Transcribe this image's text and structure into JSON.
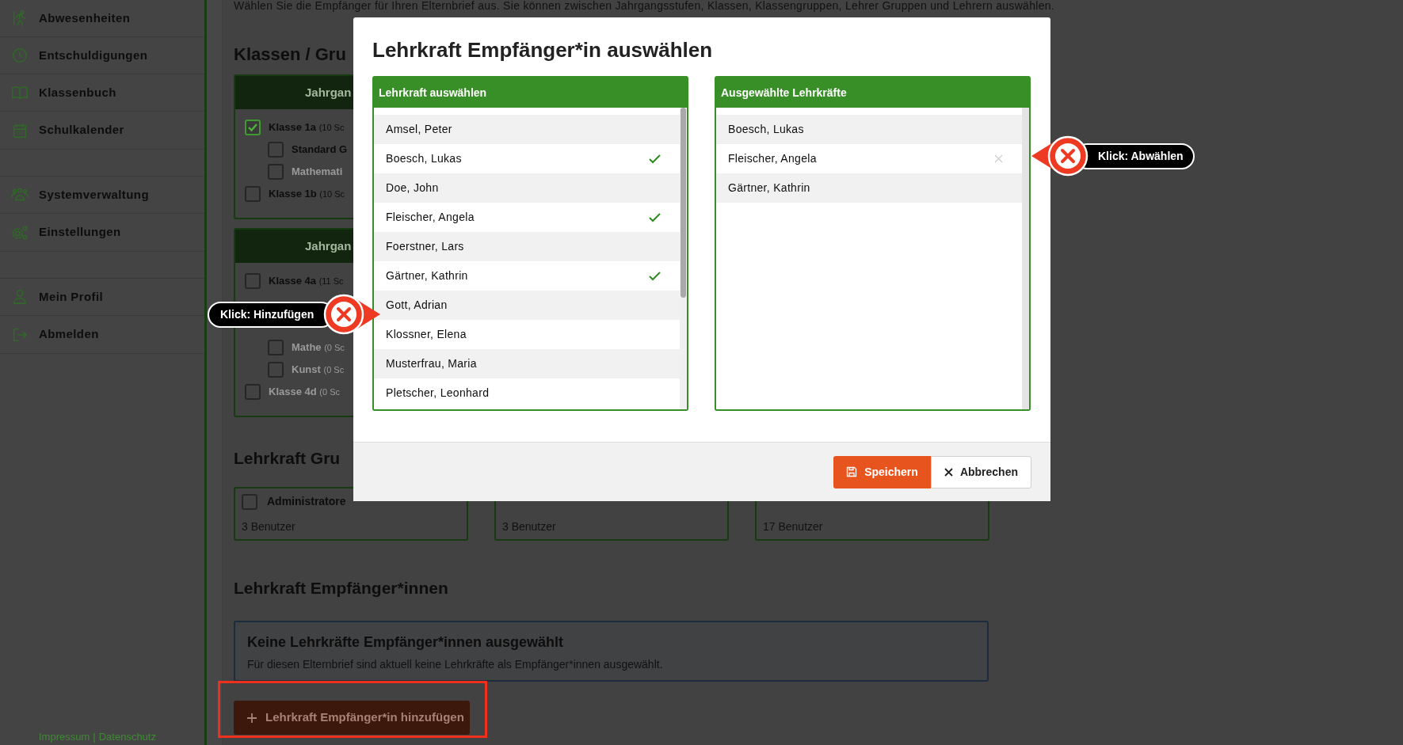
{
  "sidebar": {
    "sections": [
      {
        "items": [
          {
            "label": "Abwesenheiten"
          },
          {
            "label": "Entschuldigungen"
          },
          {
            "label": "Klassenbuch"
          },
          {
            "label": "Schulkalender"
          }
        ]
      },
      {
        "items": [
          {
            "label": "Systemverwaltung"
          },
          {
            "label": "Einstellungen"
          }
        ]
      },
      {
        "items": [
          {
            "label": "Mein Profil"
          },
          {
            "label": "Abmelden"
          }
        ]
      }
    ],
    "footer": {
      "links": [
        "Impressum",
        "Datenschutz"
      ],
      "separator": "|"
    }
  },
  "page": {
    "intro": "Wählen Sie die Empfänger für Ihren Elternbrief aus. Sie können zwischen Jahrgangsstufen, Klassen, Klassengruppen, Lehrer Gruppen und Lehrern auswählen.",
    "classes_heading": "Klassen / Gru",
    "class_cards": [
      {
        "header": "Jahrgan",
        "rows": [
          {
            "label": "Klasse 1a",
            "count": "(10 Sc",
            "checked": true,
            "disabled": false,
            "children": [
              {
                "label": "Standard G",
                "checked": false,
                "disabled": false
              },
              {
                "label": "Mathemati",
                "checked": false,
                "disabled": true
              }
            ]
          },
          {
            "label": "Klasse 1b",
            "count": "(10 Sc",
            "checked": false,
            "disabled": false
          }
        ]
      },
      {
        "header": "Jahrgan",
        "rows": [
          {
            "label": "Klasse 4a",
            "count": "(11 Sc",
            "checked": false,
            "disabled": false
          },
          {
            "children": [
              {
                "label": "Mathe",
                "count": "(0 Sc",
                "checked": false,
                "disabled": true
              },
              {
                "label": "Kunst",
                "count": "(0 Sc",
                "checked": false,
                "disabled": true
              }
            ]
          },
          {
            "label": "Klasse 4d",
            "count": "(0 Sc",
            "checked": false,
            "disabled": true
          }
        ]
      }
    ],
    "groups_heading": "Lehrkraft Gru",
    "group_cards": [
      {
        "name": "Administratore",
        "checked": false,
        "users": "3 Benutzer"
      },
      {
        "users": "3 Benutzer"
      },
      {
        "users": "17 Benutzer"
      }
    ],
    "recipients_heading": "Lehrkraft Empfänger*innen",
    "empty_notice": {
      "title": "Keine Lehrkräfte Empfänger*innen ausgewählt",
      "text": "Für diesen Elternbrief sind aktuell keine Lehrkräfte als Empfänger*innen ausgewählt."
    },
    "add_button": {
      "label": "Lehrkraft Empfänger*in hinzufügen",
      "highlighted": true
    }
  },
  "modal": {
    "title": "Lehrkraft Empfänger*in auswählen",
    "available": {
      "header": "Lehrkraft auswählen",
      "items": [
        {
          "name": "Amsel, Peter",
          "selected": false
        },
        {
          "name": "Boesch, Lukas",
          "selected": true
        },
        {
          "name": "Doe, John",
          "selected": false
        },
        {
          "name": "Fleischer, Angela",
          "selected": true
        },
        {
          "name": "Foerstner, Lars",
          "selected": false
        },
        {
          "name": "Gärtner, Kathrin",
          "selected": true
        },
        {
          "name": "Gott, Adrian",
          "selected": false
        },
        {
          "name": "Klossner, Elena",
          "selected": false
        },
        {
          "name": "Musterfrau, Maria",
          "selected": false
        },
        {
          "name": "Pletscher, Leonhard",
          "selected": false
        }
      ]
    },
    "chosen": {
      "header": "Ausgewählte Lehrkräfte",
      "items": [
        {
          "name": "Boesch, Lukas",
          "hovered": false
        },
        {
          "name": "Fleischer, Angela",
          "hovered": true
        },
        {
          "name": "Gärtner, Kathrin",
          "hovered": false
        }
      ]
    },
    "buttons": [
      {
        "label": "Speichern",
        "kind": "primary"
      },
      {
        "label": "Abbrechen",
        "kind": "secondary"
      }
    ]
  },
  "callouts": [
    {
      "label": "Klick: Hinzufügen",
      "kind": "add"
    },
    {
      "label": "Klick: Abwählen",
      "kind": "remove"
    }
  ]
}
